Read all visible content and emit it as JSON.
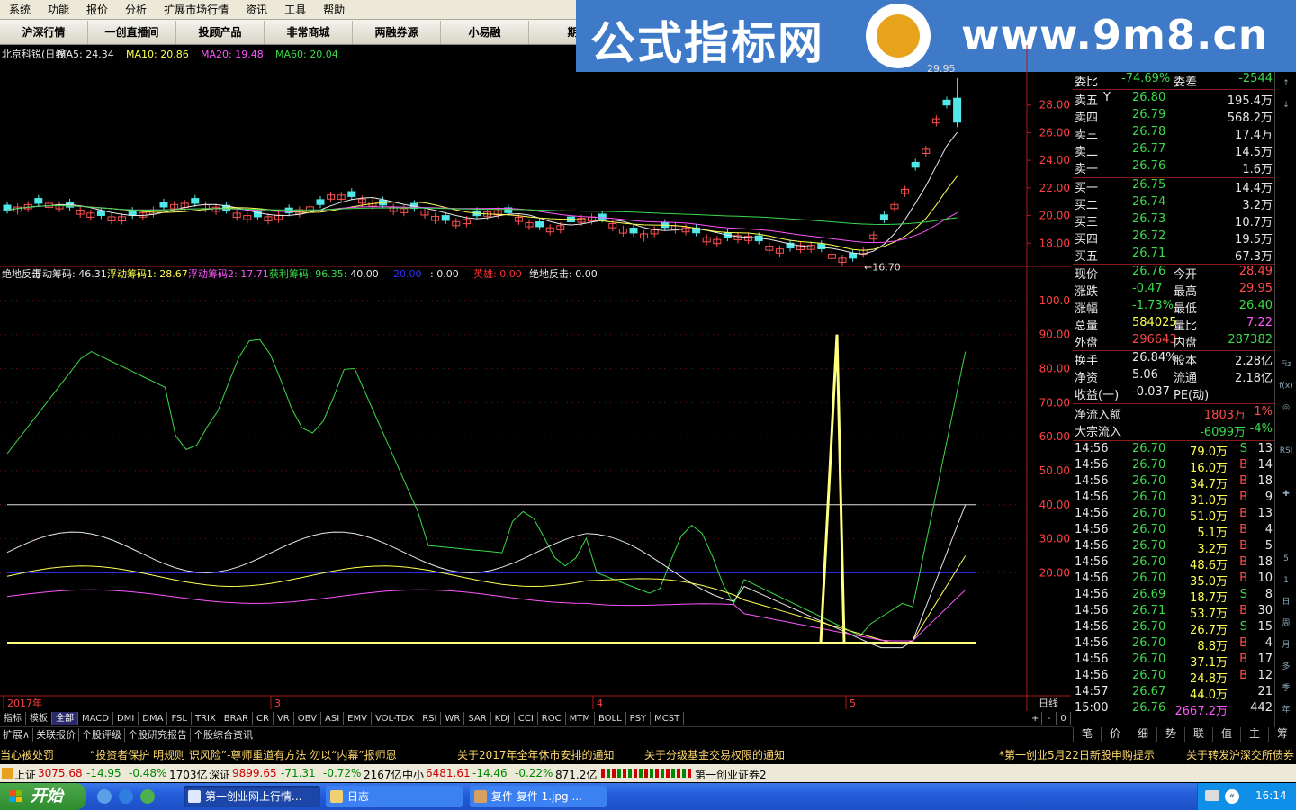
{
  "menu": [
    "系统",
    "功能",
    "报价",
    "分析",
    "扩展市场行情",
    "资讯",
    "工具",
    "帮助"
  ],
  "tabs": [
    "沪深行情",
    "一创直播间",
    "投顾产品",
    "非常商城",
    "两融券源",
    "小易融",
    "期"
  ],
  "banner": {
    "text": "公式指标网",
    "url": "www.9m8.cn",
    "seal_text": "9m8.cn"
  },
  "price_panel": {
    "header": [
      {
        "text": "北京科锐(日线)",
        "color": "#e8e8e8"
      },
      {
        "text": "MA5: 24.34",
        "color": "#e8e8e8"
      },
      {
        "text": "MA10: 20.86",
        "color": "#ffff50"
      },
      {
        "text": "MA20: 19.48",
        "color": "#ff55ff"
      },
      {
        "text": "MA60: 20.04",
        "color": "#3cd94a"
      }
    ],
    "y_ticks": [
      "28.00",
      "26.00",
      "24.00",
      "22.00",
      "20.00",
      "18.00"
    ],
    "low_label": "16.70",
    "high_label": "29.95"
  },
  "indicator_panel": {
    "header": [
      {
        "text": "绝地反击",
        "color": "#e8e8e8"
      },
      {
        "text": "浮动筹码: 46.31",
        "color": "#e8e8e8"
      },
      {
        "text": "浮动筹码1: 28.67",
        "color": "#ffff50"
      },
      {
        "text": "浮动筹码2: 17.71",
        "color": "#ff55ff"
      },
      {
        "text": "获利筹码: 96.35",
        "color": "#3cd94a"
      },
      {
        "text": ": 40.00",
        "color": "#e8e8e8"
      },
      {
        "text": "20.00",
        "color": "#3030ff"
      },
      {
        "text": ": 0.00",
        "color": "#e8e8e8"
      },
      {
        "text": "英雄: 0.00",
        "color": "#ff3030"
      },
      {
        "text": "绝地反击: 0.00",
        "color": "#e8e8e8"
      }
    ],
    "y_ticks": [
      "100.0",
      "90.00",
      "80.00",
      "70.00",
      "60.00",
      "50.00",
      "40.00",
      "30.00",
      "20.00"
    ]
  },
  "x_axis": {
    "labels": [
      "2017年",
      "3",
      "4",
      "5"
    ],
    "period": "日线"
  },
  "order_book": {
    "committee": {
      "ratio_label": "委比",
      "ratio": "-74.69%",
      "diff_label": "委差",
      "diff": "-2544"
    },
    "asks": [
      {
        "label": "卖五",
        "flag": "Y",
        "price": "26.80",
        "vol": "195.4万"
      },
      {
        "label": "卖四",
        "price": "26.79",
        "vol": "568.2万"
      },
      {
        "label": "卖三",
        "price": "26.78",
        "vol": "17.4万"
      },
      {
        "label": "卖二",
        "price": "26.77",
        "vol": "14.5万"
      },
      {
        "label": "卖一",
        "price": "26.76",
        "vol": "1.6万"
      }
    ],
    "bids": [
      {
        "label": "买一",
        "price": "26.75",
        "vol": "14.4万"
      },
      {
        "label": "买二",
        "price": "26.74",
        "vol": "3.2万"
      },
      {
        "label": "买三",
        "price": "26.73",
        "vol": "10.7万"
      },
      {
        "label": "买四",
        "price": "26.72",
        "vol": "19.5万"
      },
      {
        "label": "买五",
        "price": "26.71",
        "vol": "67.3万"
      }
    ]
  },
  "quote": [
    {
      "l1": "现价",
      "v1": "26.76",
      "c1": "green",
      "l2": "今开",
      "v2": "28.49",
      "c2": "red"
    },
    {
      "l1": "涨跌",
      "v1": "-0.47",
      "c1": "green",
      "l2": "最高",
      "v2": "29.95",
      "c2": "red"
    },
    {
      "l1": "涨幅",
      "v1": "-1.73%",
      "c1": "green",
      "l2": "最低",
      "v2": "26.40",
      "c2": "green"
    },
    {
      "l1": "总量",
      "v1": "584025",
      "c1": "yellow",
      "l2": "量比",
      "v2": "7.22",
      "c2": "magenta"
    },
    {
      "l1": "外盘",
      "v1": "296643",
      "c1": "red",
      "l2": "内盘",
      "v2": "287382",
      "c2": "green"
    }
  ],
  "fundamentals": [
    {
      "l1": "换手",
      "v1": "26.84%",
      "l2": "股本",
      "v2": "2.28亿"
    },
    {
      "l1": "净资",
      "v1": "5.06",
      "l2": "流通",
      "v2": "2.18亿"
    },
    {
      "l1": "收益(一)",
      "v1": "-0.037",
      "l2": "PE(动)",
      "v2": "—"
    }
  ],
  "flows": [
    {
      "label": "净流入额",
      "value": "1803万",
      "pct": "1%",
      "color": "red"
    },
    {
      "label": "大宗流入",
      "value": "-6099万",
      "pct": "-4%",
      "color": "green"
    }
  ],
  "ticks": [
    {
      "time": "14:56",
      "price": "26.70",
      "vol": "79.0万",
      "side": "S",
      "n": "13"
    },
    {
      "time": "14:56",
      "price": "26.70",
      "vol": "16.0万",
      "side": "B",
      "n": "14"
    },
    {
      "time": "14:56",
      "price": "26.70",
      "vol": "34.7万",
      "side": "B",
      "n": "18"
    },
    {
      "time": "14:56",
      "price": "26.70",
      "vol": "31.0万",
      "side": "B",
      "n": "9"
    },
    {
      "time": "14:56",
      "price": "26.70",
      "vol": "51.0万",
      "side": "B",
      "n": "13"
    },
    {
      "time": "14:56",
      "price": "26.70",
      "vol": "5.1万",
      "side": "B",
      "n": "4"
    },
    {
      "time": "14:56",
      "price": "26.70",
      "vol": "3.2万",
      "side": "B",
      "n": "5"
    },
    {
      "time": "14:56",
      "price": "26.70",
      "vol": "48.6万",
      "side": "B",
      "n": "18"
    },
    {
      "time": "14:56",
      "price": "26.70",
      "vol": "35.0万",
      "side": "B",
      "n": "10"
    },
    {
      "time": "14:56",
      "price": "26.69",
      "vol": "18.7万",
      "side": "S",
      "n": "8"
    },
    {
      "time": "14:56",
      "price": "26.71",
      "vol": "53.7万",
      "side": "B",
      "n": "30"
    },
    {
      "time": "14:56",
      "price": "26.70",
      "vol": "26.7万",
      "side": "S",
      "n": "15"
    },
    {
      "time": "14:56",
      "price": "26.70",
      "vol": "8.8万",
      "side": "B",
      "n": "4"
    },
    {
      "time": "14:56",
      "price": "26.70",
      "vol": "37.1万",
      "side": "B",
      "n": "17"
    },
    {
      "time": "14:56",
      "price": "26.70",
      "vol": "24.8万",
      "side": "B",
      "n": "12"
    },
    {
      "time": "14:57",
      "price": "26.67",
      "vol": "44.0万",
      "side": "",
      "n": "21"
    },
    {
      "time": "15:00",
      "price": "26.76",
      "vol": "2667.2万",
      "side": "",
      "n": "442"
    }
  ],
  "right_icons": [
    "↑",
    "↓",
    "",
    "",
    "",
    "",
    "",
    "",
    "",
    "",
    "",
    "",
    "",
    "Fiz",
    "f(x)",
    "◎",
    "",
    "RSI",
    "",
    "✚",
    "",
    "",
    "5",
    "1",
    "日",
    "周",
    "月",
    "多",
    "季",
    "年"
  ],
  "indicator_tabs": [
    "指标",
    "模板",
    "全部",
    "MACD",
    "DMI",
    "DMA",
    "FSL",
    "TRIX",
    "BRAR",
    "CR",
    "VR",
    "OBV",
    "ASI",
    "EMV",
    "VOL-TDX",
    "RSI",
    "WR",
    "SAR",
    "KDJ",
    "CCI",
    "ROC",
    "MTM",
    "BOLL",
    "PSY",
    "MCST"
  ],
  "ext_tabs": [
    "扩展∧",
    "关联报价",
    "个股评级",
    "个股研究报告",
    "个股综合资讯"
  ],
  "rp_bottom_tabs": [
    "笔",
    "价",
    "细",
    "势",
    "联",
    "值",
    "主",
    "筹"
  ],
  "zoom_controls": [
    "+",
    "-",
    "0"
  ],
  "ticker": [
    "当心被处罚",
    "“投资者保护 明规则 识风险”-尊师重道有方法 勿以“内幕”报师恩",
    "关于2017年全年休市安排的通知",
    "关于分级基金交易权限的通知",
    "*第一创业5月22日新股申购提示",
    "关于转发沪深交所债券"
  ],
  "indexbar": {
    "sh": {
      "label": "上证",
      "value": "3075.68",
      "chg": "-14.95",
      "pct": "-0.48%",
      "amt": "1703亿"
    },
    "sz": {
      "label": "深证",
      "value": "9899.65",
      "chg": "-71.31",
      "pct": "-0.72%",
      "amt": "2167亿"
    },
    "zx": {
      "label": "中小",
      "value": "6481.61",
      "chg": "-14.46",
      "pct": "-0.22%",
      "amt": "871.2亿"
    },
    "broker": "第一创业证券2"
  },
  "taskbar": {
    "start": "开始",
    "tasks": [
      "第一创业网上行情...",
      "日志",
      "复件 复件 1.jpg ..."
    ],
    "clock": "16:14"
  },
  "chart_data": [
    {
      "type": "candlestick",
      "title": "北京科锐(日线)",
      "ylim": [
        16,
        30
      ],
      "annotations": {
        "low": 16.7,
        "high": 29.95
      },
      "last": {
        "open": 28.49,
        "high": 29.95,
        "low": 26.4,
        "close": 26.76
      },
      "series": [
        {
          "name": "MA5",
          "value": 24.34
        },
        {
          "name": "MA10",
          "value": 20.86
        },
        {
          "name": "MA20",
          "value": 19.48
        },
        {
          "name": "MA60",
          "value": 20.04
        }
      ]
    },
    {
      "type": "line",
      "title": "绝地反击",
      "ylim": [
        0,
        105
      ],
      "reference_lines": [
        40,
        20,
        0
      ],
      "series": [
        {
          "name": "浮动筹码",
          "color": "#e8e8e8",
          "last": 46.31
        },
        {
          "name": "浮动筹码1",
          "color": "#ffff50",
          "last": 28.67
        },
        {
          "name": "浮动筹码2",
          "color": "#ff55ff",
          "last": 17.71
        },
        {
          "name": "获利筹码",
          "color": "#3cd94a",
          "last": 96.35
        }
      ]
    }
  ]
}
